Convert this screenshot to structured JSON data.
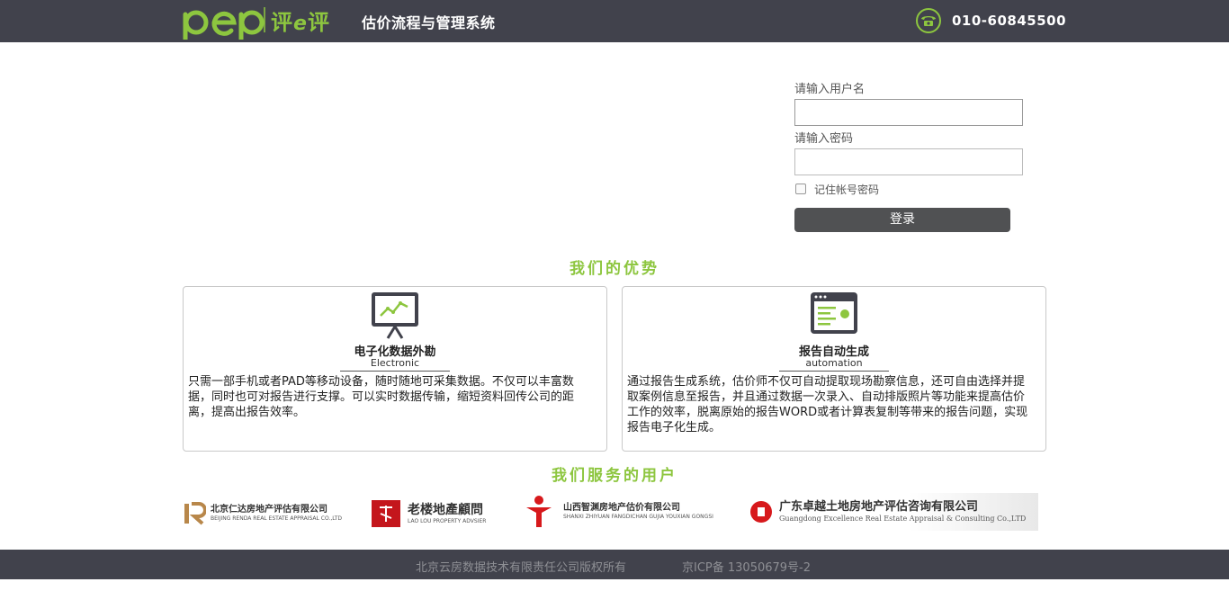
{
  "header": {
    "logo_text": "pep 评e评",
    "system_title": "估价流程与管理系统",
    "phone_icon": "phone-icon",
    "phone": "010-60845500"
  },
  "login": {
    "username_label": "请输入用户名",
    "username_value": "",
    "password_label": "请输入密码",
    "password_value": "",
    "remember_label": "记住帐号密码",
    "remember_checked": false,
    "submit_label": "登录"
  },
  "advantages": {
    "title": "我们的优势",
    "cards": [
      {
        "icon": "monitor-chart-icon",
        "title": "电子化数据外勘",
        "subtitle": "Electronic",
        "description": "只需一部手机或者PAD等移动设备，随时随地可采集数据。不仅可以丰富数据，同时也可对报告进行支撑。可以实时数据传输，缩短资料回传公司的距离，提高出报告效率。"
      },
      {
        "icon": "report-window-icon",
        "title": "报告自动生成",
        "subtitle": "automation",
        "description": "通过报告生成系统，估价师不仅可自动提取现场勘察信息，还可自由选择并提取案例信息至报告，并且通过数据一次录入、自动排版照片等功能来提高估价工作的效率，脱离原始的报告WORD或者计算表复制等带来的报告问题，实现报告电子化生成。"
      }
    ]
  },
  "clients": {
    "title": "我们服务的用户",
    "items": [
      {
        "name": "北京仁达房地产评估有限公司",
        "en": "BEIJING RENDA REAL ESTATE APPRAISAL CO.,LTD"
      },
      {
        "name": "老楼地產顧問",
        "en": "LAO LOU PROPERTY ADVSIER"
      },
      {
        "name": "山西智渊房地产估价有限公司",
        "en": "SHANXI ZHIYUAN FANGDICHAN GUJIA YOUXIAN GONGSI"
      },
      {
        "name": "广东卓越土地房地产评估咨询有限公司",
        "en": "Guangdong Excellence Real Estate Appraisal & Consulting Co.,LTD"
      }
    ]
  },
  "footer": {
    "copyright": "北京云房数据技术有限责任公司版权所有",
    "icp": "京ICP备 13050679号-2"
  },
  "colors": {
    "header_bg": "#41424c",
    "accent_green": "#8dc63f",
    "button_bg": "#505153"
  }
}
